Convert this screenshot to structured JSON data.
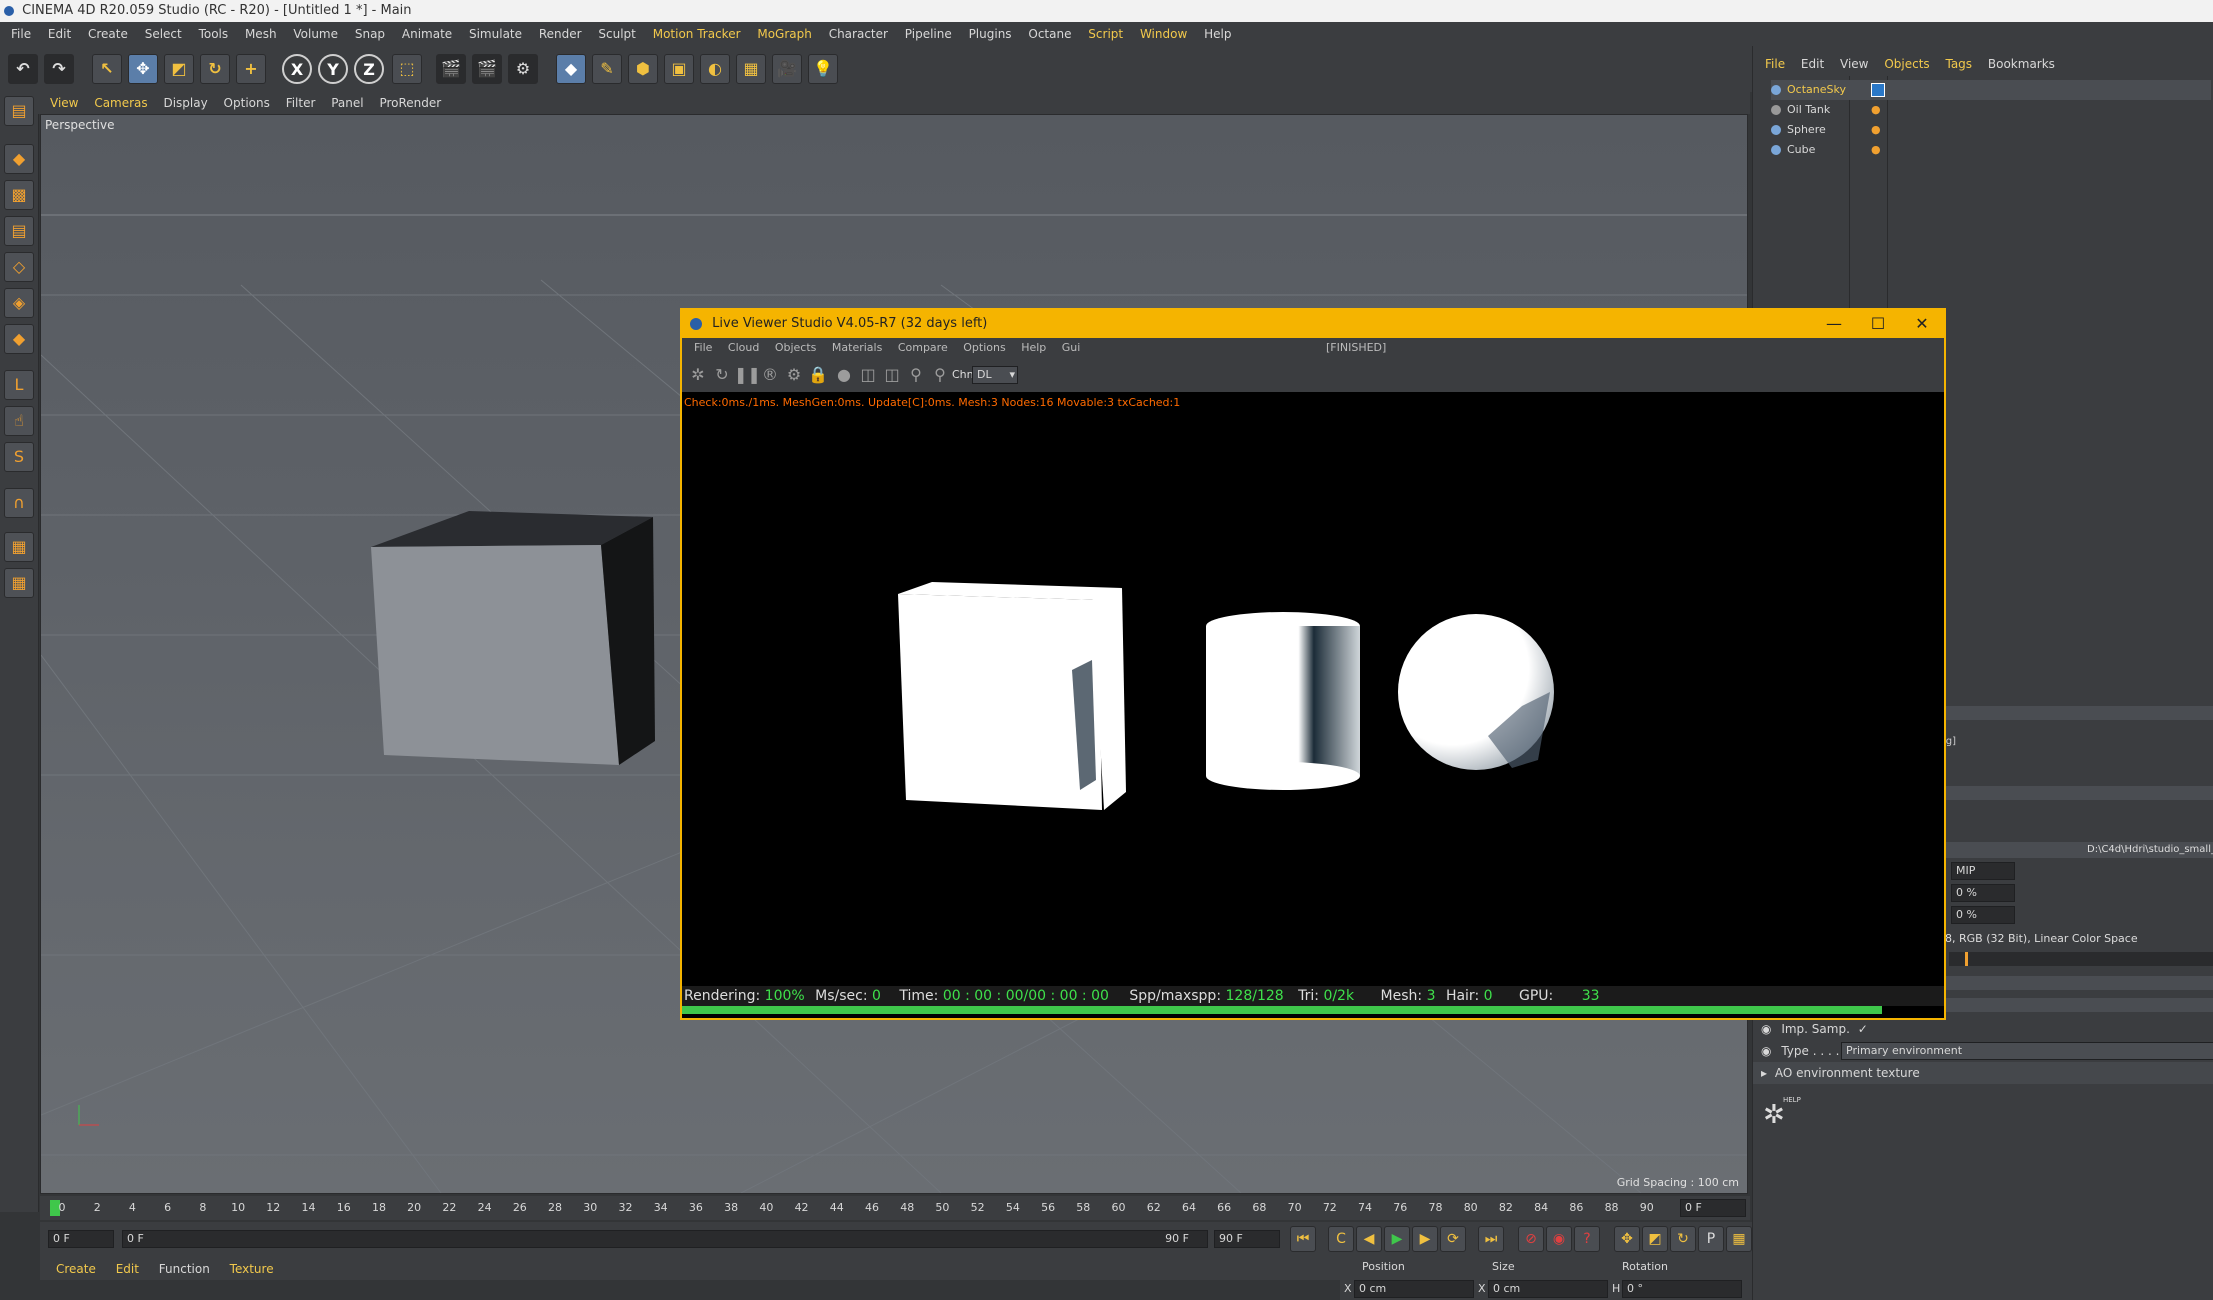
{
  "app": {
    "title": "CINEMA 4D R20.059 Studio (RC - R20) - [Untitled 1 *] - Main"
  },
  "menubar": [
    "File",
    "Edit",
    "Create",
    "Select",
    "Tools",
    "Mesh",
    "Volume",
    "Snap",
    "Animate",
    "Simulate",
    "Render",
    "Sculpt",
    "Motion Tracker",
    "MoGraph",
    "Character",
    "Pipeline",
    "Plugins",
    "Octane",
    "Script",
    "Window",
    "Help"
  ],
  "toolbar": {
    "axis_x": "X",
    "axis_y": "Y",
    "axis_z": "Z"
  },
  "viewport": {
    "menu": [
      "View",
      "Cameras",
      "Display",
      "Options",
      "Filter",
      "Panel",
      "ProRender"
    ],
    "label": "Perspective",
    "grid_spacing": "Grid Spacing : 100 cm"
  },
  "object_manager": {
    "tabs": [
      "File",
      "Edit",
      "View",
      "Objects",
      "Tags",
      "Bookmarks"
    ],
    "objects": [
      "OctaneSky",
      "Oil Tank",
      "Sphere",
      "Cube"
    ]
  },
  "attributes": {
    "path_value": "D:\\C4d\\Hdri\\studio_small_",
    "mip_value": "MIP",
    "pct_1": "0 %",
    "pct_2": "0 %",
    "color_info": "8, RGB (32 Bit), Linear Color Space",
    "bg_fragment": "ig]",
    "imp_samp_label": "Imp. Samp.",
    "imp_samp_check": "✓",
    "type_label": "Type . . . .",
    "type_value": "Primary environment",
    "ao_label": "AO environment texture",
    "help_label": "HELP"
  },
  "timeline": {
    "ticks": [
      "0",
      "2",
      "4",
      "6",
      "8",
      "10",
      "12",
      "14",
      "16",
      "18",
      "20",
      "22",
      "24",
      "26",
      "28",
      "30",
      "32",
      "34",
      "36",
      "38",
      "40",
      "42",
      "44",
      "46",
      "48",
      "50",
      "52",
      "54",
      "56",
      "58",
      "60",
      "62",
      "64",
      "66",
      "68",
      "70",
      "72",
      "74",
      "76",
      "78",
      "80",
      "82",
      "84",
      "86",
      "88",
      "90"
    ],
    "current_frame": "0 F"
  },
  "transport": {
    "start_field": "0 F",
    "range_start": "0 F",
    "range_end": "90 F",
    "end_field": "90 F"
  },
  "bottom_menu": [
    "Create",
    "Edit",
    "Function",
    "Texture"
  ],
  "coords": {
    "position_label": "Position",
    "size_label": "Size",
    "rotation_label": "Rotation",
    "x_label": "X",
    "pos_x": "0 cm",
    "size_x_label": "X",
    "size_x": "0 cm",
    "rot_h_label": "H",
    "rot_h": "0 °"
  },
  "live_viewer": {
    "title": "Live Viewer Studio V4.05-R7 (32 days left)",
    "menu": [
      "File",
      "Cloud",
      "Objects",
      "Materials",
      "Compare",
      "Options",
      "Help",
      "Gui"
    ],
    "status": "[FINISHED]",
    "channel_label": "Chn:",
    "channel_value": "DL",
    "log": "Check:0ms./1ms. MeshGen:0ms. Update[C]:0ms. Mesh:3 Nodes:16 Movable:3 txCached:1",
    "rendering_label": "Rendering:",
    "rendering_value": "100%",
    "mssec_label": "Ms/sec:",
    "mssec_value": "0",
    "time_label": "Time:",
    "time_value": "00 : 00 : 00/00 : 00 : 00",
    "spp_label": "Spp/maxspp:",
    "spp_value": "128/128",
    "tri_label": "Tri:",
    "tri_value": "0/2k",
    "mesh_label": "Mesh:",
    "mesh_value": "3",
    "hair_label": "Hair:",
    "hair_value": "0",
    "gpu_label": "GPU:",
    "gpu_value": "33",
    "progress": 1.0
  },
  "colors": {
    "accent": "#f5b400",
    "green": "#3fc74b",
    "highlight_text": "#f2c94c"
  }
}
